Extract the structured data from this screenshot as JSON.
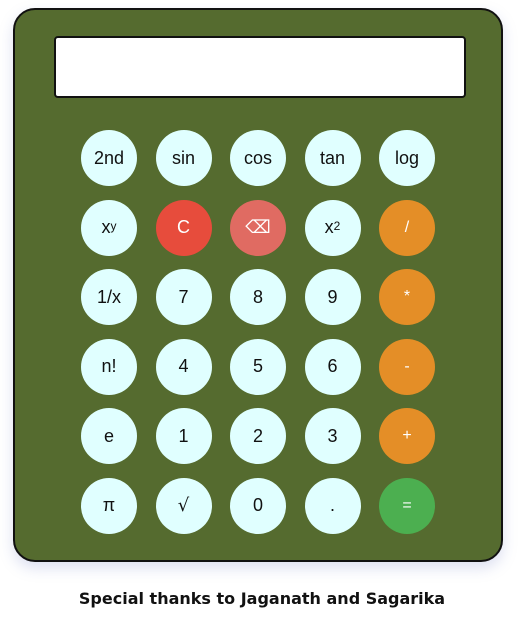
{
  "display": {
    "value": ""
  },
  "buttons": {
    "second": "2nd",
    "sin": "sin",
    "cos": "cos",
    "tan": "tan",
    "log": "log",
    "power_base": "x",
    "power_exp": "y",
    "clear": "C",
    "backspace": "⌫",
    "square_base": "x",
    "square_exp": "2",
    "divide": "/",
    "reciprocal": "1/x",
    "seven": "7",
    "eight": "8",
    "nine": "9",
    "multiply": "*",
    "factorial": "n!",
    "four": "4",
    "five": "5",
    "six": "6",
    "subtract": "-",
    "e": "e",
    "one": "1",
    "two": "2",
    "three": "3",
    "add": "+",
    "pi": "π",
    "sqrt": "√",
    "zero": "0",
    "decimal": ".",
    "equals": "="
  },
  "colors": {
    "body": "#556b2f",
    "key": "#e0ffff",
    "clear": "#e74c3c",
    "backspace": "#e06b62",
    "operator": "#e48e27",
    "equals": "#4caf50"
  },
  "footer": {
    "thanks": "Special thanks to Jaganath and Sagarika"
  }
}
